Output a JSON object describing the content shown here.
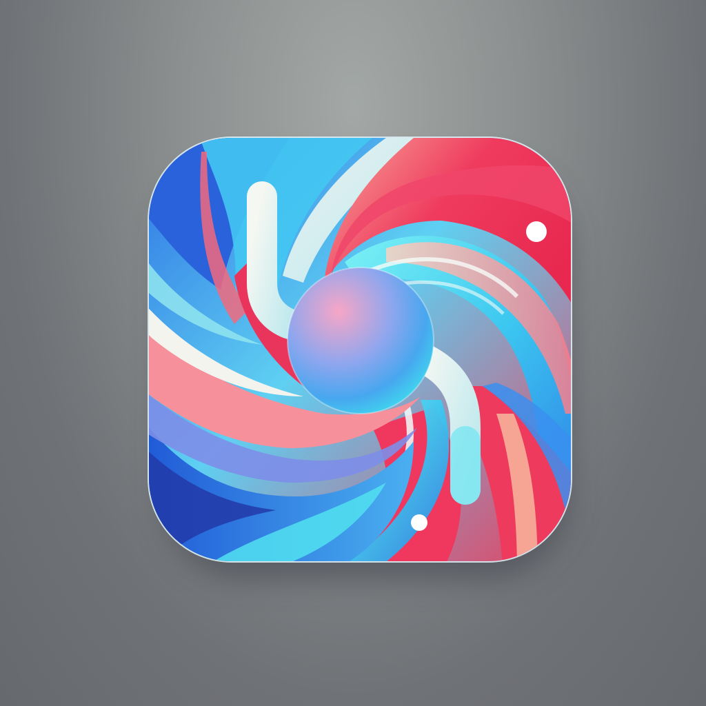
{
  "scene": {
    "background_color": "#7a7e80",
    "subject": "app-icon",
    "icon_colors": {
      "blue": "#2f6fe0",
      "cyan": "#3fe3f0",
      "red": "#f0385e",
      "peach": "#f6b09a",
      "white": "#eef3f2"
    }
  }
}
